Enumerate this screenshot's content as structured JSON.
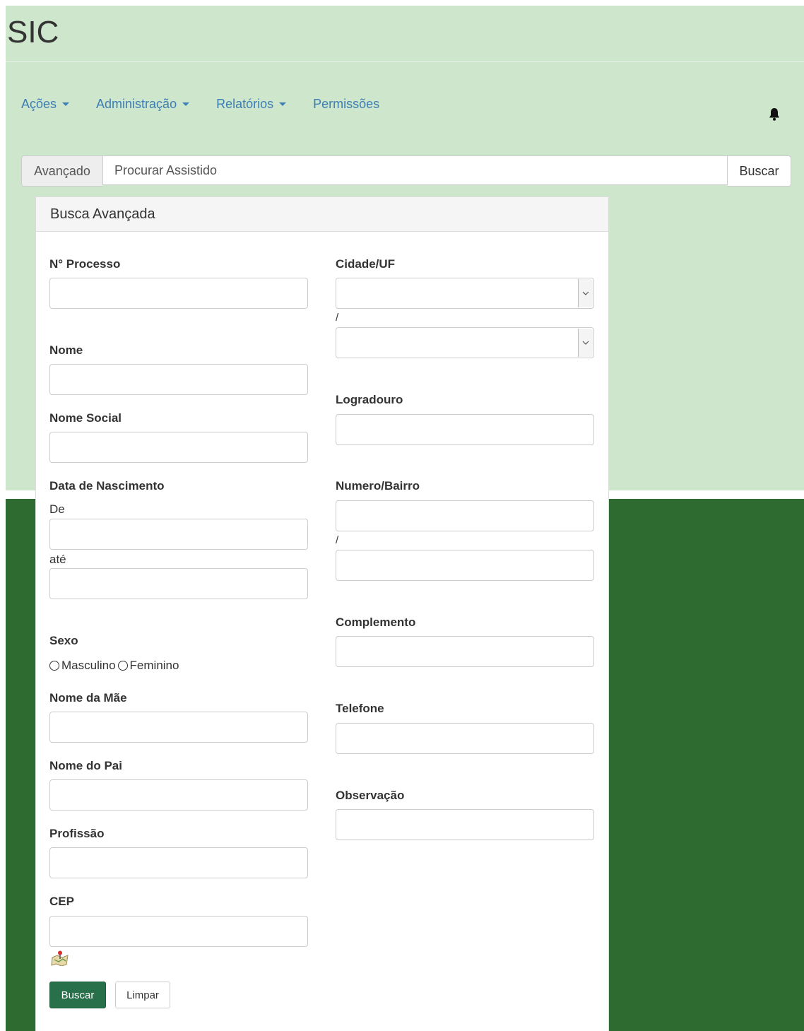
{
  "app": {
    "title": "SIC"
  },
  "nav": {
    "items": [
      {
        "label": "Ações",
        "dropdown": true
      },
      {
        "label": "Administração",
        "dropdown": true
      },
      {
        "label": "Relatórios",
        "dropdown": true
      },
      {
        "label": "Permissões",
        "dropdown": false
      }
    ],
    "bell_icon": "bell-icon"
  },
  "search": {
    "advanced_label": "Avançado",
    "placeholder": "Procurar Assistido",
    "button_label": "Buscar"
  },
  "panel": {
    "title": "Busca Avançada",
    "fields": {
      "processo": "N° Processo",
      "nome": "Nome",
      "nome_social": "Nome Social",
      "data_nascimento": "Data de Nascimento",
      "de": "De",
      "ate": "até",
      "sexo": "Sexo",
      "sexo_options": [
        "Masculino",
        "Feminino"
      ],
      "nome_mae": "Nome da Mãe",
      "nome_pai": "Nome do Pai",
      "profissao": "Profissão",
      "cep": "CEP",
      "cidade_uf": "Cidade/UF",
      "separator": "/",
      "logradouro": "Logradouro",
      "numero_bairro": "Numero/Bairro",
      "complemento": "Complemento",
      "telefone": "Telefone",
      "observacao": "Observação"
    },
    "buttons": {
      "search": "Buscar",
      "clear": "Limpar"
    }
  },
  "colors": {
    "top_bg": "#cde6cc",
    "bottom_bg": "#2e6b31",
    "link": "#3d7eb5",
    "primary_button": "#27704a"
  }
}
